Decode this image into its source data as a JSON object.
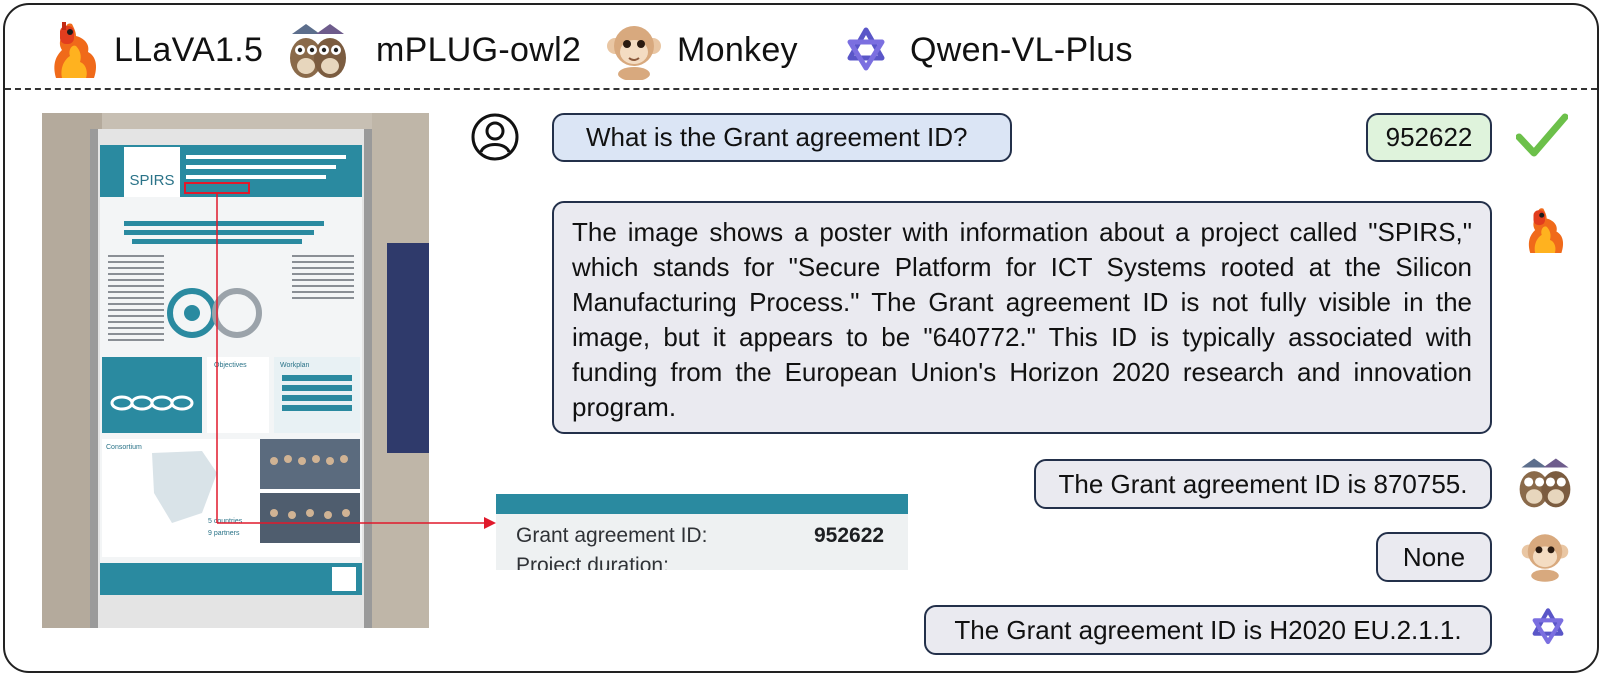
{
  "models": [
    {
      "name": "LLaVA1.5",
      "icon": "flame-llama-icon"
    },
    {
      "name": "mPLUG-owl2",
      "icon": "owl-pair-icon"
    },
    {
      "name": "Monkey",
      "icon": "monkey-icon"
    },
    {
      "name": "Qwen-VL-Plus",
      "icon": "qwen-logo-icon"
    }
  ],
  "question": "What is the Grant agreement ID?",
  "ground_truth": "952622",
  "answers": [
    {
      "model": "LLaVA1.5",
      "text": "The image shows a poster with information about a project called \"SPIRS,\" which stands for \"Secure Platform for ICT Systems rooted at the Silicon Manufacturing Process.\" The Grant agreement ID is not fully visible in the image, but it appears to be \"640772.\" This ID is typically associated with funding from the European Union's Horizon 2020 research and innovation program."
    },
    {
      "model": "mPLUG-owl2",
      "text": "The Grant agreement ID is 870755."
    },
    {
      "model": "Monkey",
      "text": "None"
    },
    {
      "model": "Qwen-VL-Plus",
      "text": "The Grant agreement ID is H2020 EU.2.1.1."
    }
  ],
  "poster": {
    "title": "SECURE PLATFORM FOR ICT SYSTEMS ROOTED AT THE SILICON MANUFACTURING PROCESS (SPIRS)",
    "logo": "SPIRS",
    "headline": "SPIRS addresses innovative approaches to provide security and data-privacy to future Information and Communications Technology (ICT) elements",
    "sections": [
      "Objectives",
      "Workplan",
      "Consortium"
    ],
    "stats": [
      "5 countries",
      "9 partners"
    ]
  },
  "zoom_crop": {
    "label": "Grant agreement ID:",
    "value": "952622",
    "partial_label": "Project duration:"
  },
  "colors": {
    "check": "#6cc04a",
    "question_bg": "#dbe5f5",
    "gt_bg": "#dff3dc",
    "answer_bg": "#eaeaf0",
    "highlight": "#e0192b"
  }
}
